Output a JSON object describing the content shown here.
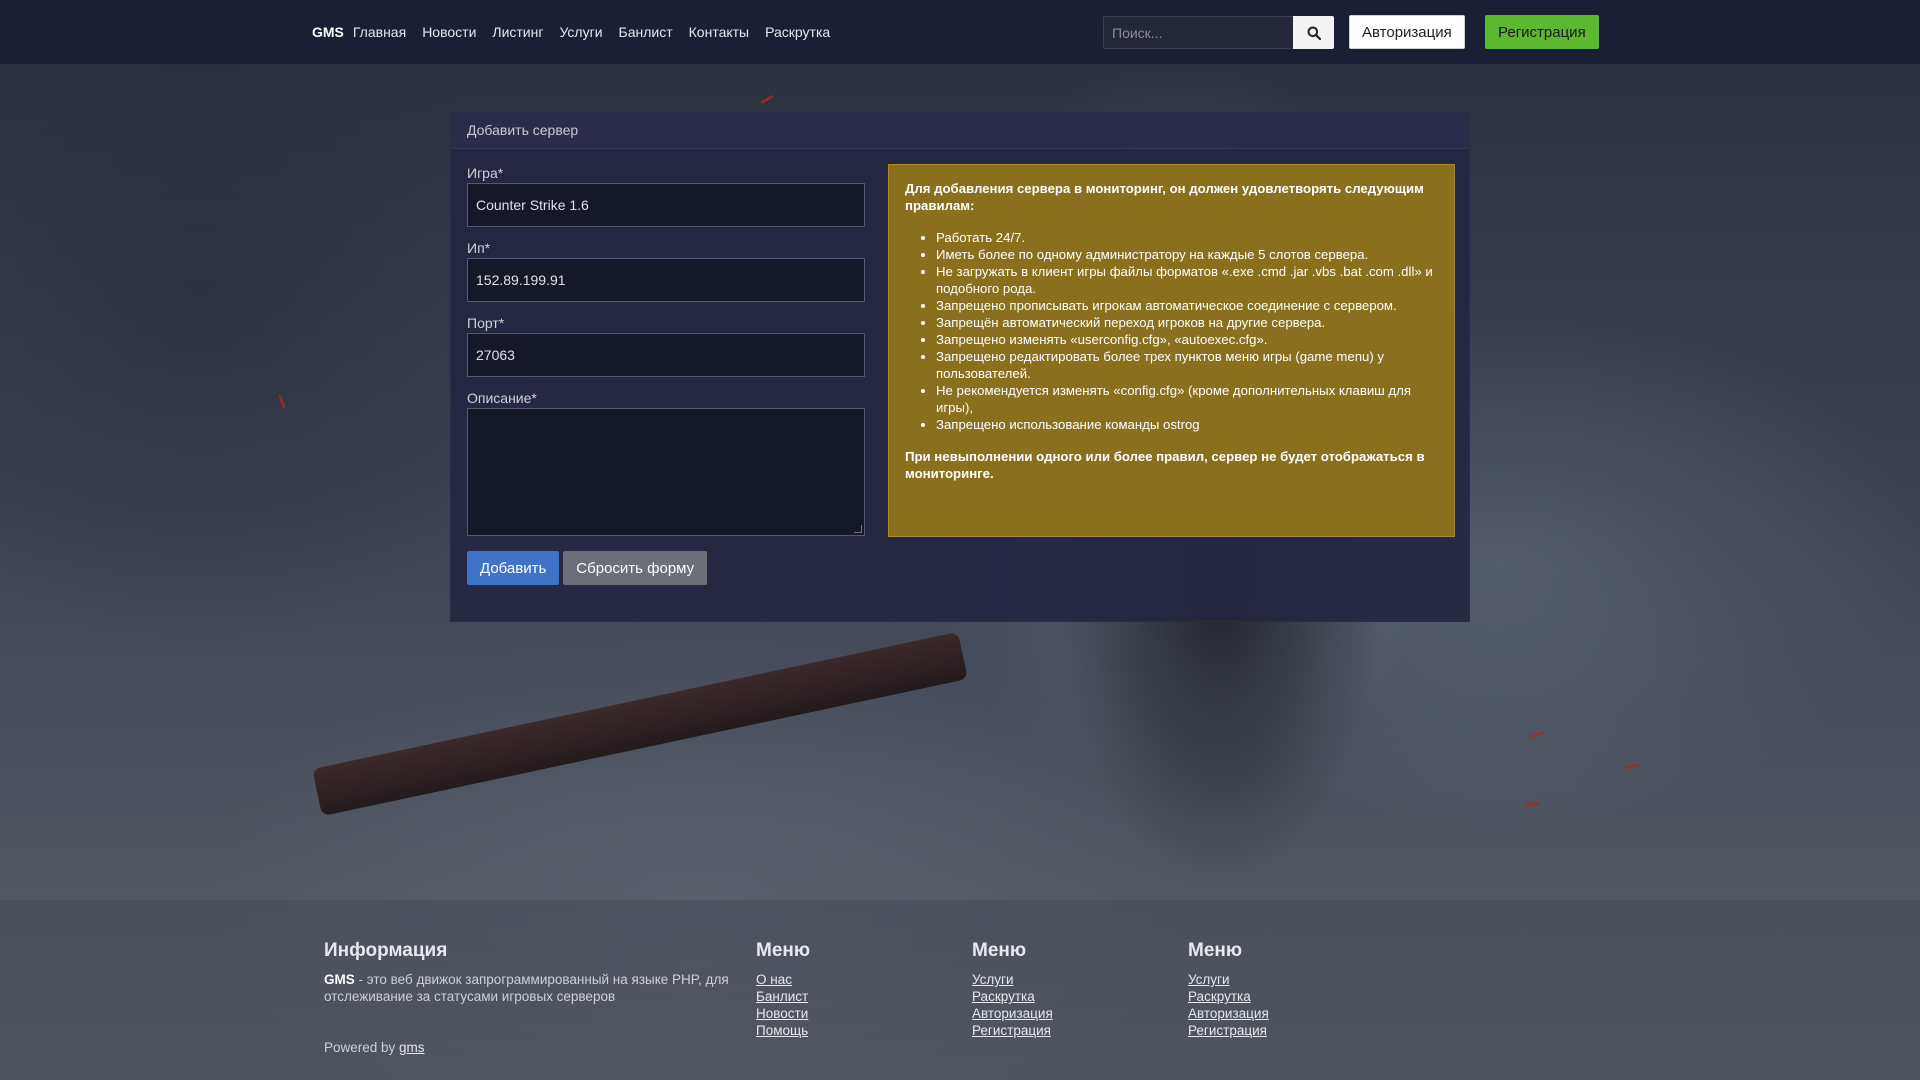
{
  "navbar": {
    "brand": "GMS",
    "links": [
      "Главная",
      "Новости",
      "Листинг",
      "Услуги",
      "Банлист",
      "Контакты",
      "Раскрутка"
    ],
    "search_placeholder": "Поиск...",
    "login_label": "Авторизация",
    "register_label": "Регистрация"
  },
  "panel": {
    "title": "Добавить сервер",
    "fields": {
      "game_label": "Игра*",
      "game_value": "Counter Strike 1.6",
      "ip_label": "Ип*",
      "ip_value": "152.89.199.91",
      "port_label": "Порт*",
      "port_value": "27063",
      "description_label": "Описание*",
      "description_value": ""
    },
    "add_button": "Добавить",
    "reset_button": "Сбросить форму",
    "rules": {
      "title": "Для добавления сервера в мониторинг, он должен удовлетворять следующим правилам:",
      "items": [
        "Работать 24/7.",
        "Иметь более по одному администратору на каждые 5 слотов сервера.",
        "Не загружать в клиент игры файлы форматов «.exe .cmd .jar .vbs .bat .com .dll» и подобного рода.",
        "Запрещено прописывать игрокам автоматическое соединение с сервером.",
        "Запрещён автоматический переход игроков на другие сервера.",
        "Запрещено изменять  «userconfig.cfg», «autoexec.cfg».",
        "Запрещено редактировать более трех пунктов меню игры (game menu) у пользователей.",
        "Не рекомендуется изменять «config.cfg» (кроме дополнительных клавиш для игры),",
        "Запрещено использование команды ostrog"
      ],
      "footer": "При невыполнении одного или более правил, сервер не будет отображаться в мониторинге."
    }
  },
  "footer": {
    "info_title": "Информация",
    "info_brand": "GMS",
    "info_text": " - это веб движок запрограммированный на языке PHP, для отслеживание за статусами игровых серверов",
    "col1": {
      "title": "Меню",
      "links": [
        "О нас",
        "Банлист",
        "Новости",
        "Помощь"
      ]
    },
    "col2": {
      "title": "Меню",
      "links": [
        "Услуги",
        "Раскрутка",
        "Авторизация",
        "Регистрация"
      ]
    },
    "col3": {
      "title": "Меню",
      "links": [
        "Услуги",
        "Раскрутка",
        "Авторизация",
        "Регистрация"
      ]
    },
    "powered_prefix": "Powered by ",
    "powered_link": "gms"
  },
  "icons": {
    "search": "search-icon"
  },
  "colors": {
    "navbar_bg": "#1b1f36",
    "register_button": "#5cb82e",
    "add_button": "#3f73c8",
    "reset_button": "#6c6e78",
    "rules_box": "#8a6f1e"
  }
}
